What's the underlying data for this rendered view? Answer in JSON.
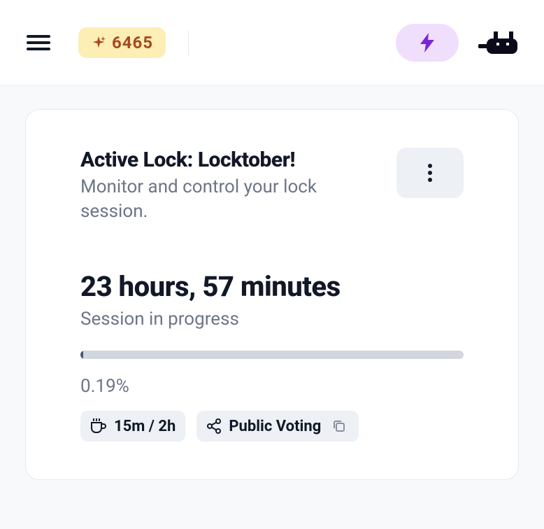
{
  "header": {
    "points_value": "6465"
  },
  "card": {
    "title": "Active Lock: Locktober!",
    "subtitle": "Monitor and control your lock session.",
    "time_value": "23 hours, 57 minutes",
    "time_status": "Session in progress",
    "percent_label": "0.19%",
    "progress_percent": 0.19,
    "chips": {
      "coffee": {
        "label": "15m / 2h"
      },
      "voting": {
        "label": "Public Voting"
      }
    }
  },
  "colors": {
    "points_bg": "#fdeeb6",
    "points_fg": "#a64a1d",
    "bolt_bg": "#f0defd",
    "bolt_fg": "#7c25d6",
    "chip_bg": "#edf0f5",
    "progress_track": "#d2d6df"
  }
}
